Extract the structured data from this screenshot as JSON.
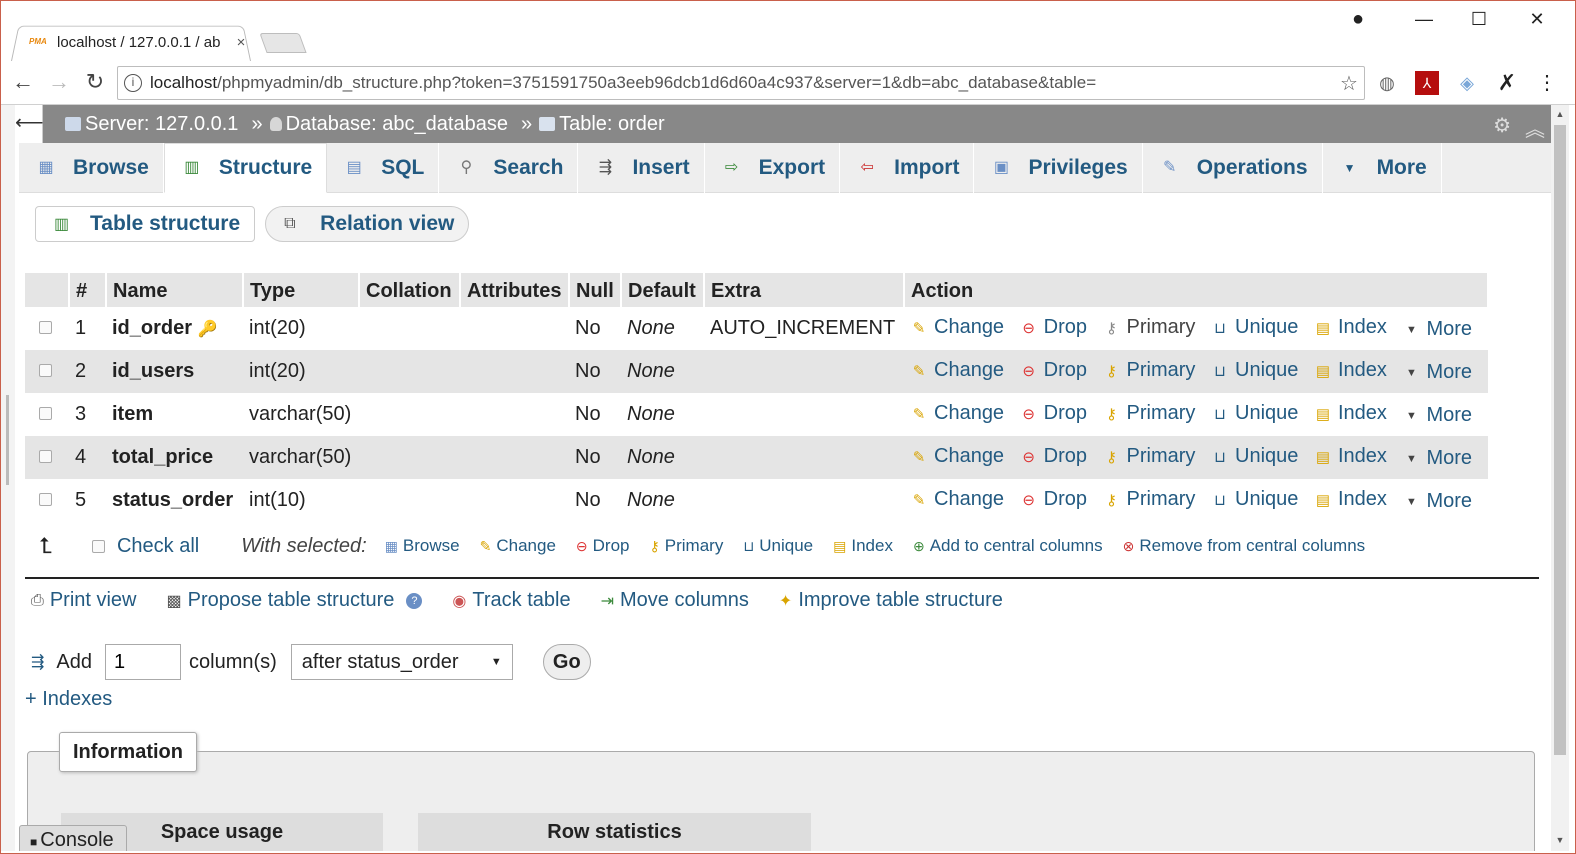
{
  "browser": {
    "tab_title": "localhost / 127.0.0.1 / ab",
    "tab_favicon": "PMA",
    "tab_close": "×",
    "url_host": "localhost",
    "url_path": "/phpmyadmin/db_structure.php?token=3751591750a3eeb96dcb1d6d60a4c937&server=1&db=abc_database&table=",
    "minimize": "—",
    "maximize": "☐",
    "close": "✕"
  },
  "breadcrumb": {
    "server": "Server: 127.0.0.1",
    "database": "Database: abc_database",
    "table": "Table: order",
    "separator": "»"
  },
  "tabs": [
    {
      "label": "Browse",
      "icon": "▦"
    },
    {
      "label": "Structure",
      "icon": "▥"
    },
    {
      "label": "SQL",
      "icon": "▤"
    },
    {
      "label": "Search",
      "icon": "⚲"
    },
    {
      "label": "Insert",
      "icon": "⇶"
    },
    {
      "label": "Export",
      "icon": "⇨"
    },
    {
      "label": "Import",
      "icon": "⇦"
    },
    {
      "label": "Privileges",
      "icon": "▣"
    },
    {
      "label": "Operations",
      "icon": "✎"
    },
    {
      "label": "More",
      "icon": "▼"
    }
  ],
  "subtabs": {
    "table_structure": "Table structure",
    "relation_view": "Relation view"
  },
  "table": {
    "headers": [
      "#",
      "Name",
      "Type",
      "Collation",
      "Attributes",
      "Null",
      "Default",
      "Extra",
      "Action"
    ],
    "rows": [
      {
        "num": "1",
        "name": "id_order",
        "type": "int(20)",
        "collation": "",
        "attributes": "",
        "null": "No",
        "default": "None",
        "extra": "AUTO_INCREMENT"
      },
      {
        "num": "2",
        "name": "id_users",
        "type": "int(20)",
        "collation": "",
        "attributes": "",
        "null": "No",
        "default": "None",
        "extra": ""
      },
      {
        "num": "3",
        "name": "item",
        "type": "varchar(50)",
        "collation": "",
        "attributes": "",
        "null": "No",
        "default": "None",
        "extra": ""
      },
      {
        "num": "4",
        "name": "total_price",
        "type": "varchar(50)",
        "collation": "",
        "attributes": "",
        "null": "No",
        "default": "None",
        "extra": ""
      },
      {
        "num": "5",
        "name": "status_order",
        "type": "int(10)",
        "collation": "",
        "attributes": "",
        "null": "No",
        "default": "None",
        "extra": ""
      }
    ],
    "actions": {
      "change": "Change",
      "drop": "Drop",
      "primary": "Primary",
      "unique": "Unique",
      "index": "Index",
      "more": "More"
    }
  },
  "with_selected": {
    "check_all": "Check all",
    "label": "With selected:",
    "browse": "Browse",
    "change": "Change",
    "drop": "Drop",
    "primary": "Primary",
    "unique": "Unique",
    "index": "Index",
    "add_central": "Add to central columns",
    "remove_central": "Remove from central columns"
  },
  "links": {
    "print_view": "Print view",
    "propose": "Propose table structure",
    "track": "Track table",
    "move": "Move columns",
    "improve": "Improve table structure"
  },
  "add_column": {
    "add": "Add",
    "count": "1",
    "unit": "column(s)",
    "position": "after status_order",
    "go": "Go"
  },
  "indexes": "+ Indexes",
  "information": {
    "title": "Information",
    "space_usage": "Space usage",
    "row_statistics": "Row statistics"
  },
  "console": "Console"
}
